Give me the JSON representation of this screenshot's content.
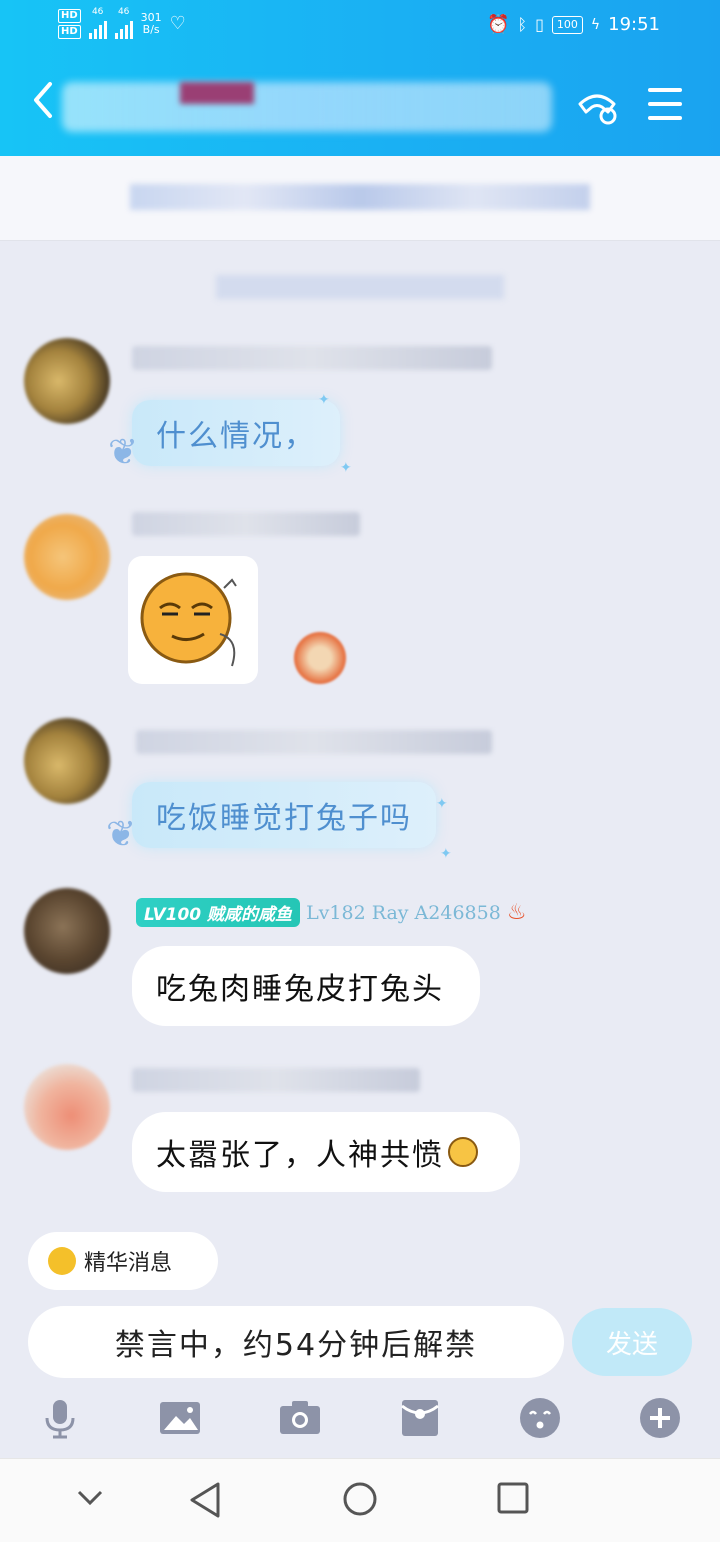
{
  "status_bar": {
    "network_speed": "301",
    "network_unit": "B/s",
    "signal1_label": "46",
    "signal2_label": "46",
    "battery": "100",
    "time": "19:51"
  },
  "messages": [
    {
      "type": "text",
      "text": "什么情况，",
      "style": "ice"
    },
    {
      "type": "sticker"
    },
    {
      "type": "text",
      "text": "吃饭睡觉打兔子吗",
      "style": "ice"
    },
    {
      "type": "text",
      "text": "吃兔肉睡兔皮打兔头",
      "style": "white",
      "level_tag": "LV100 贼咸的咸鱼",
      "sender_name": "Lv182 Ray A246858"
    },
    {
      "type": "text",
      "text": "太嚣张了，人神共愤",
      "style": "white"
    }
  ],
  "essence_label": "精华消息",
  "input": {
    "muted_text": "禁言中，约54分钟后解禁"
  },
  "send_label": "发送",
  "toolbar": [
    "mic-icon",
    "image-icon",
    "camera-icon",
    "red-packet-icon",
    "emoji-icon",
    "plus-icon"
  ],
  "navbar": [
    "collapse-icon",
    "back-triangle-icon",
    "home-circle-icon",
    "recents-square-icon"
  ],
  "colors": {
    "header": "#1ab0f3",
    "background": "#e9ebf4",
    "send_disabled": "#c1e9f8"
  }
}
